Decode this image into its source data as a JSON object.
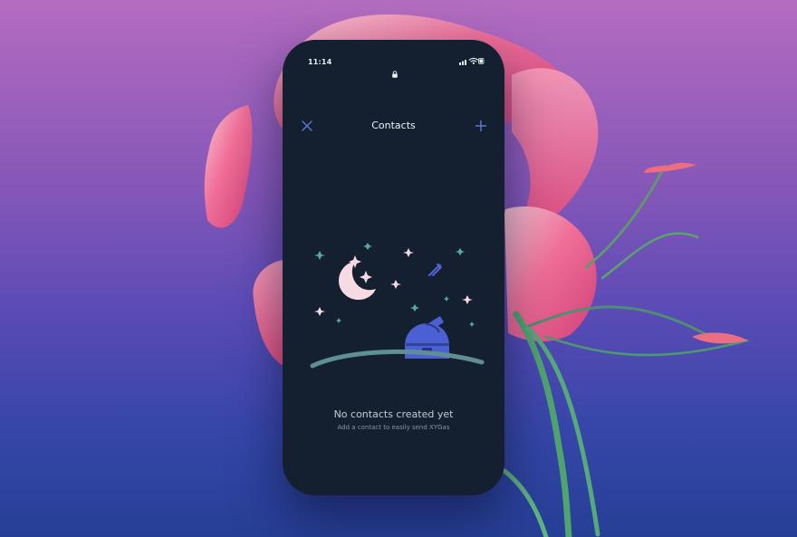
{
  "status_bar": {
    "time": "11:14"
  },
  "nav": {
    "title": "Contacts",
    "close_icon": "close-icon",
    "add_icon": "plus-icon"
  },
  "empty_state": {
    "title": "No contacts created yet",
    "subtitle": "Add a contact to easily send XYGas"
  },
  "colors": {
    "phone_background": "#14202f",
    "accent_blue": "#4f65d6",
    "moon": "#f7dbe4",
    "ground": "#5f8f95"
  }
}
